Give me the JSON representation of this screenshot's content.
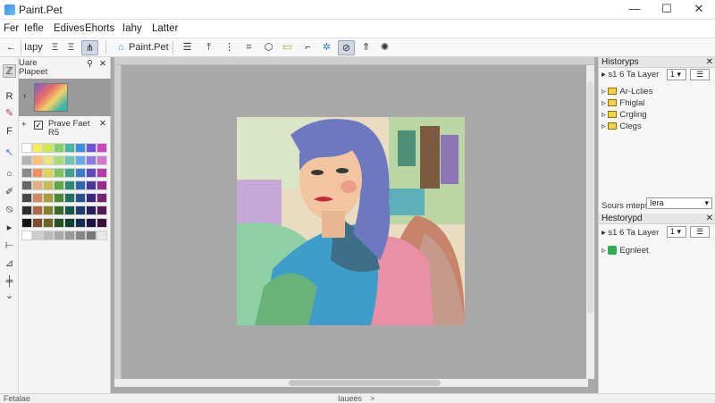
{
  "window": {
    "title": "Paint.Pet",
    "minimize": "—",
    "maximize": "☐",
    "close": "✕"
  },
  "menu": [
    "Fer",
    "Iefle",
    "Edives",
    "Ehorts",
    "Iahy",
    "Latter"
  ],
  "toolbar": {
    "back_icon": "←",
    "tool_a": "Iapy",
    "tool_b": "Ξ",
    "tool_c": "Ξ",
    "app_label": "Paint.Pet"
  },
  "left": {
    "layer_panel_title_1": "Uare",
    "layer_panel_title_2": "Plapeet",
    "layer_header_pin": "⚲",
    "layer_close": "✕",
    "props_title_1": "Prave Faet",
    "props_title_2": "R5",
    "props_plus": "+",
    "props_close": "✕",
    "palette": [
      [
        "#ffffff",
        "#f3ee56",
        "#cde849",
        "#7fd36a",
        "#49b8a0",
        "#3b8fe0",
        "#6b56d8",
        "#c947c4"
      ],
      [
        "#b3b3b3",
        "#f6c07a",
        "#e9e67c",
        "#a4dd79",
        "#6cc7b2",
        "#65a9e6",
        "#8c7adf",
        "#d575cc"
      ],
      [
        "#8a8a8a",
        "#f08f5e",
        "#dbd455",
        "#7ec55a",
        "#40a28b",
        "#3a7ec9",
        "#5f48bb",
        "#b53aaa"
      ],
      [
        "#666666",
        "#e6ac84",
        "#c5bd4e",
        "#5fa645",
        "#2d8a75",
        "#2e66ad",
        "#4b379a",
        "#922f8c"
      ],
      [
        "#474747",
        "#d3895f",
        "#a89f3b",
        "#4b8836",
        "#20705f",
        "#24528d",
        "#3a297b",
        "#73236e"
      ],
      [
        "#2e2e2e",
        "#a86a45",
        "#898128",
        "#386b28",
        "#16584a",
        "#1a3f6e",
        "#2a1d5e",
        "#561a53"
      ],
      [
        "#141414",
        "#7c4b31",
        "#6b641d",
        "#27511c",
        "#0d4136",
        "#112d52",
        "#1c1343",
        "#3b113a"
      ],
      [
        "#ffffff",
        "#cccccc",
        "#bbbbbb",
        "#aaaaaa",
        "#999999",
        "#888888",
        "#777777",
        "#e8e8e8"
      ]
    ]
  },
  "right": {
    "history_title": "Historyps",
    "history_close": "✕",
    "history_top_item": "s1 6 Ta Layer",
    "history_items": [
      "Ar-Lclies",
      "Fhiglal",
      "Crgling",
      "Clegs"
    ],
    "history_spin": "1",
    "sort_label": "Sours mteps",
    "sort_value": "Iera",
    "layers_title": "Hestorypd",
    "layers_close": "✕",
    "layers_top_item": "s1 6 Ta Layer",
    "layers_items": [
      "Egnleet"
    ],
    "layers_spin": "1"
  },
  "status": {
    "left": "Fetalae",
    "center": "Iauees",
    "arrow": ">"
  },
  "colors": {
    "canvas_bg": "#a9a9a9",
    "accent": "#3a8ee6"
  }
}
